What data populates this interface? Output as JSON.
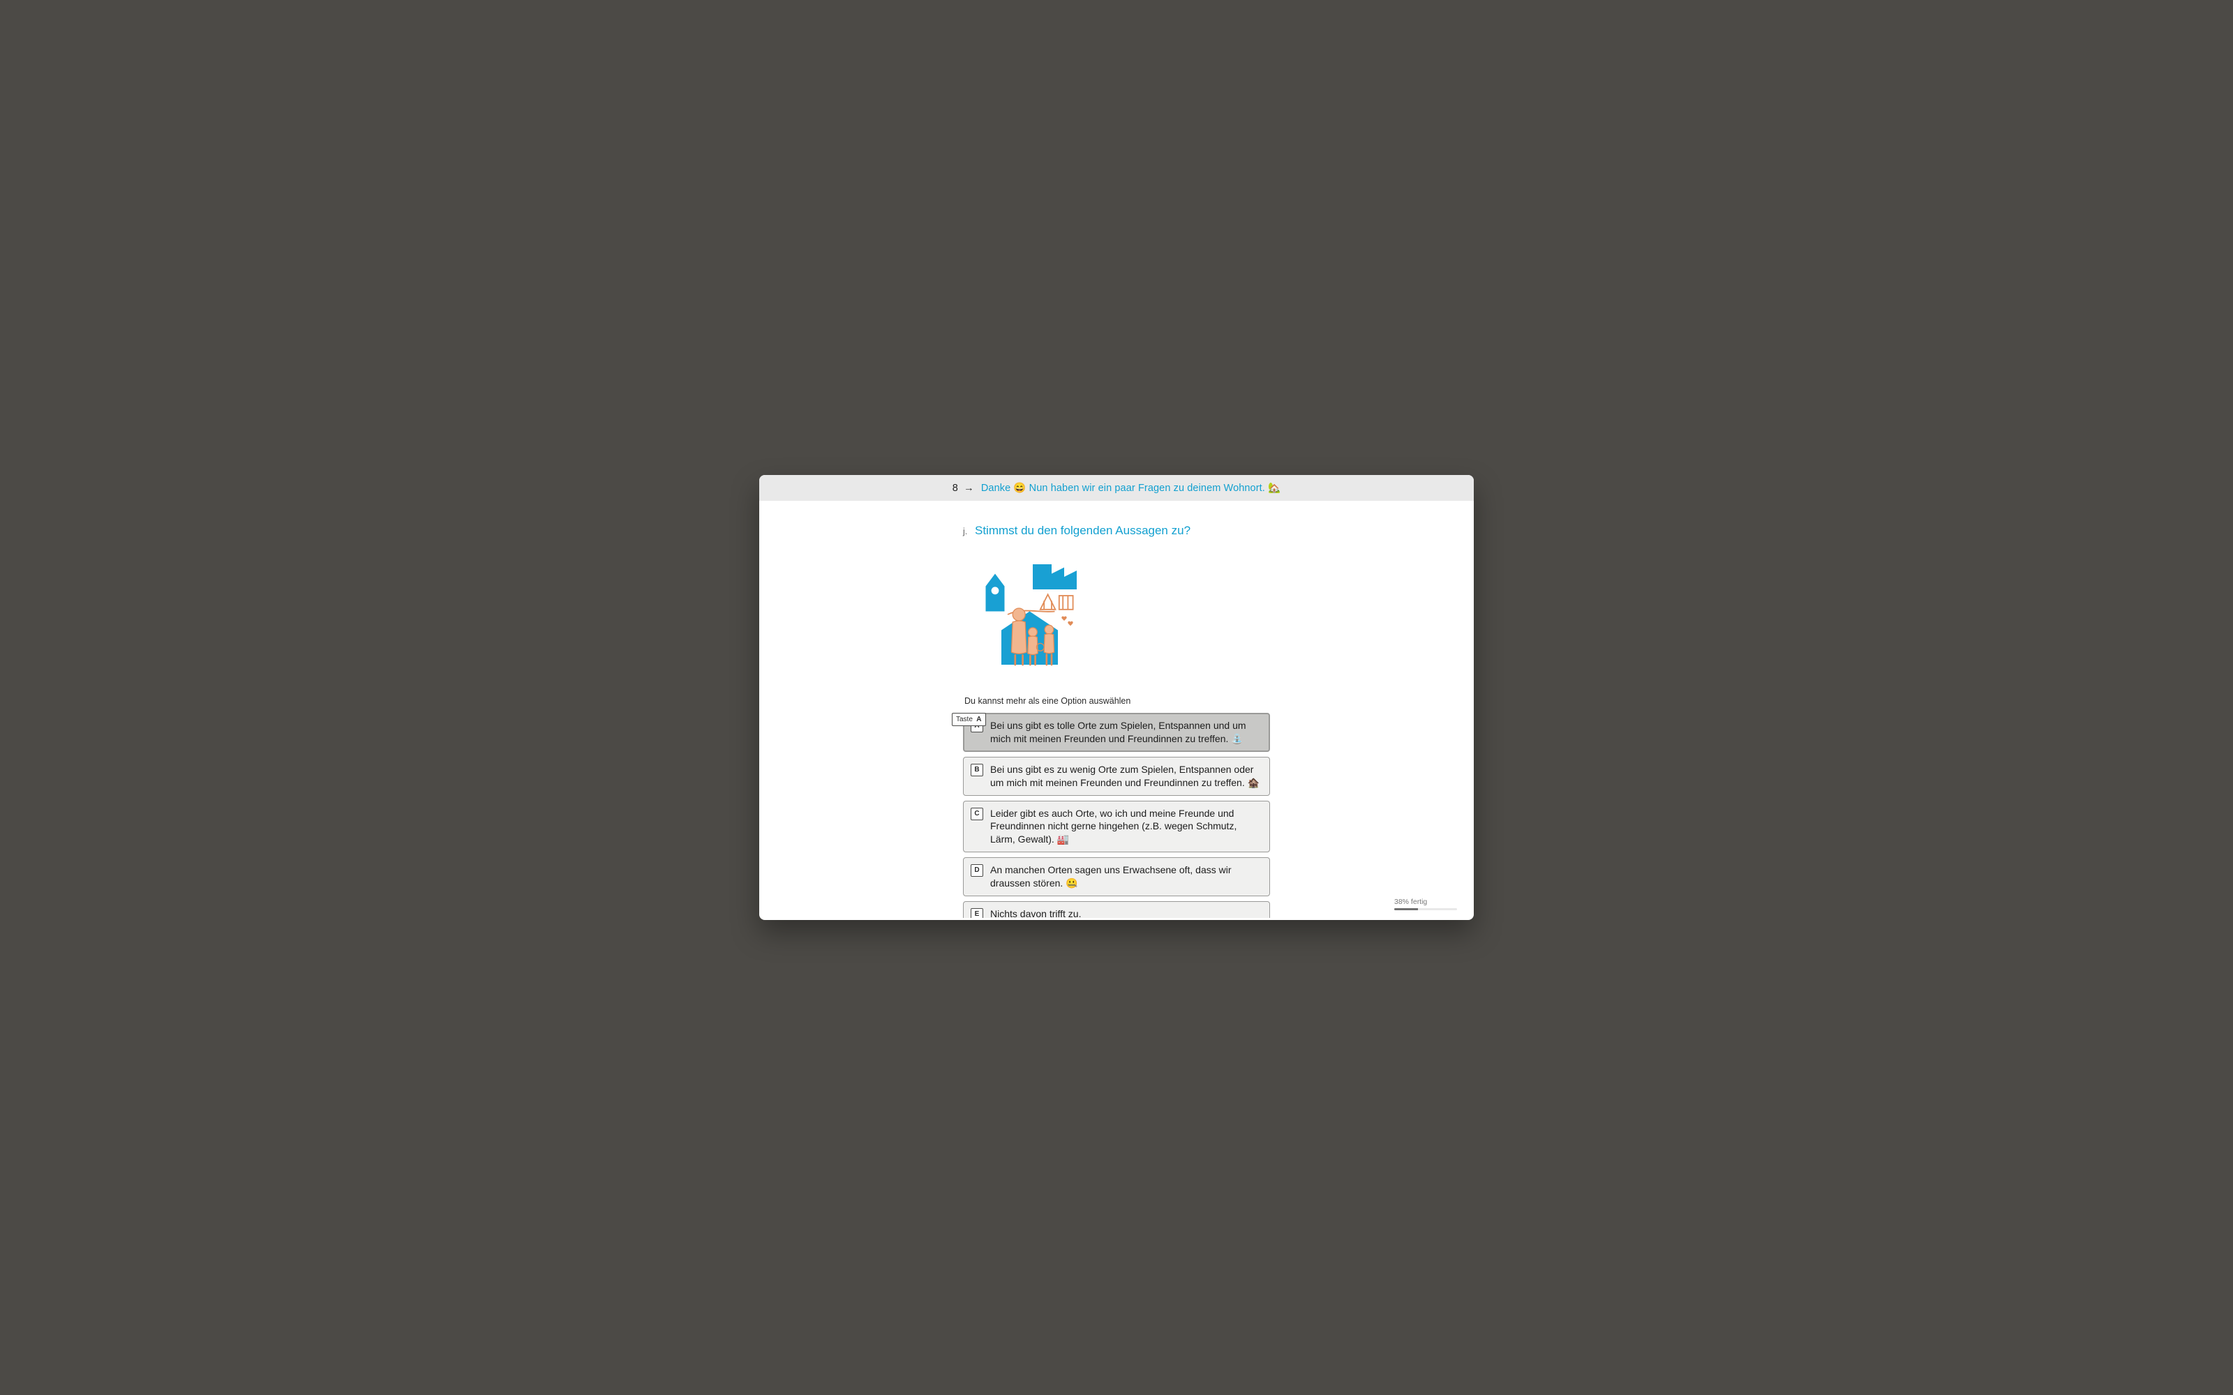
{
  "banner": {
    "number": "8",
    "arrow": "→",
    "text": "Danke 😄 Nun haben wir ein paar Fragen zu deinem Wohnort. 🏡"
  },
  "question": {
    "marker": "j.",
    "title": "Stimmst du den folgenden Aussagen zu?",
    "instruction": "Du kannst mehr als eine Option auswählen"
  },
  "taste_hint": {
    "word": "Taste",
    "key": "A"
  },
  "options": [
    {
      "key": "A",
      "label": "Bei uns gibt es tolle Orte zum Spielen, Entspannen und um mich mit meinen Freunden und Freundinnen zu treffen. ⛲",
      "selected": true
    },
    {
      "key": "B",
      "label": "Bei uns gibt es zu wenig Orte zum Spielen, Entspannen oder um mich mit meinen Freunden und Freundinnen zu treffen. 🏚️",
      "selected": false
    },
    {
      "key": "C",
      "label": "Leider gibt es auch Orte, wo ich und meine Freunde und Freundinnen nicht gerne hingehen (z.B. wegen Schmutz, Lärm, Gewalt). 🏭",
      "selected": false
    },
    {
      "key": "D",
      "label": "An manchen Orten sagen uns Erwachsene oft, dass wir draussen stören. 🤐",
      "selected": false
    },
    {
      "key": "E",
      "label": "Nichts davon trifft zu.",
      "selected": false
    }
  ],
  "progress": {
    "label": "38% fertig",
    "percent": 38
  },
  "colors": {
    "accent": "#12a0d0",
    "illus_blue": "#19a0d3",
    "illus_skin": "#f2b68f",
    "illus_line": "#e18c58"
  }
}
